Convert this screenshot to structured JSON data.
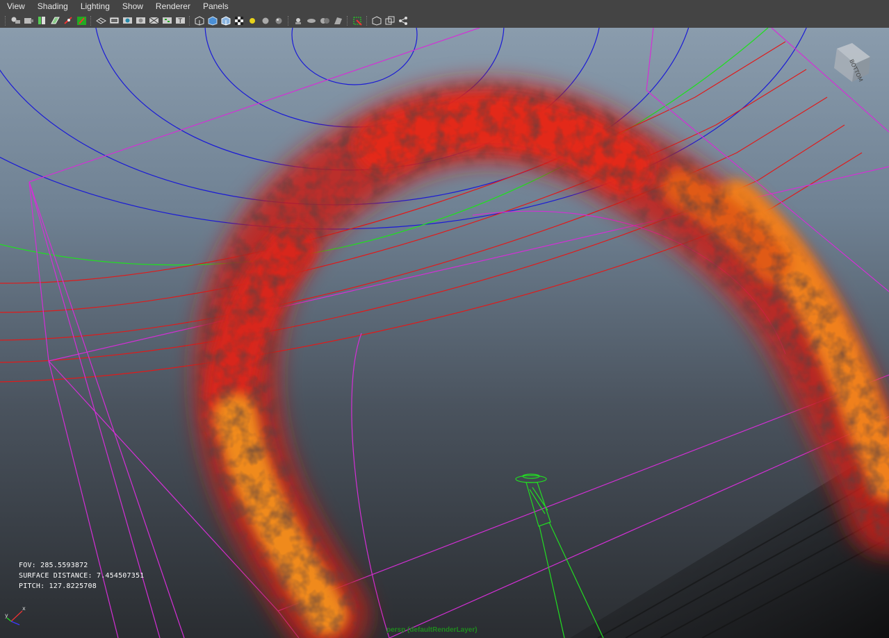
{
  "menubar": {
    "items": [
      "View",
      "Shading",
      "Lighting",
      "Show",
      "Renderer",
      "Panels"
    ]
  },
  "toolbar": {
    "icons": [
      "select-camera-icon",
      "camera-attributes-icon",
      "bookmarks-icon",
      "image-plane-icon",
      "2d-pan-zoom-icon",
      "grease-pencil-icon",
      "grid-icon",
      "film-gate-icon",
      "resolution-gate-icon",
      "gate-mask-icon",
      "field-chart-icon",
      "safe-title-icon",
      "wireframe-icon",
      "smooth-shade-icon",
      "wireframe-on-shaded-icon",
      "textured-icon",
      "use-all-lights-icon",
      "shadows-icon",
      "screen-space-ao-icon",
      "motion-blur-icon",
      "anti-aliasing-icon",
      "depth-of-field-icon",
      "isolate-select-icon",
      "xray-icon",
      "xray-joints-icon",
      "xray-components-icon"
    ]
  },
  "viewport": {
    "view_cube_label": "BOTTOM",
    "hud": {
      "fov": "FOV: 285.5593872",
      "surface_distance": "SURFACE DISTANCE: 7.454507351",
      "pitch": "PITCH: 127.8225708"
    },
    "layer_label": "persp (defaultRenderLayer)",
    "axis": {
      "x_label": "x",
      "y_label": "y"
    },
    "colors": {
      "wire_magenta": "#d42fd6",
      "wire_red": "#e01a1a",
      "wire_blue": "#1a1ad6",
      "wire_green": "#22dd22",
      "fire_red": "#d8261a",
      "fire_orange": "#f08a1c"
    }
  }
}
